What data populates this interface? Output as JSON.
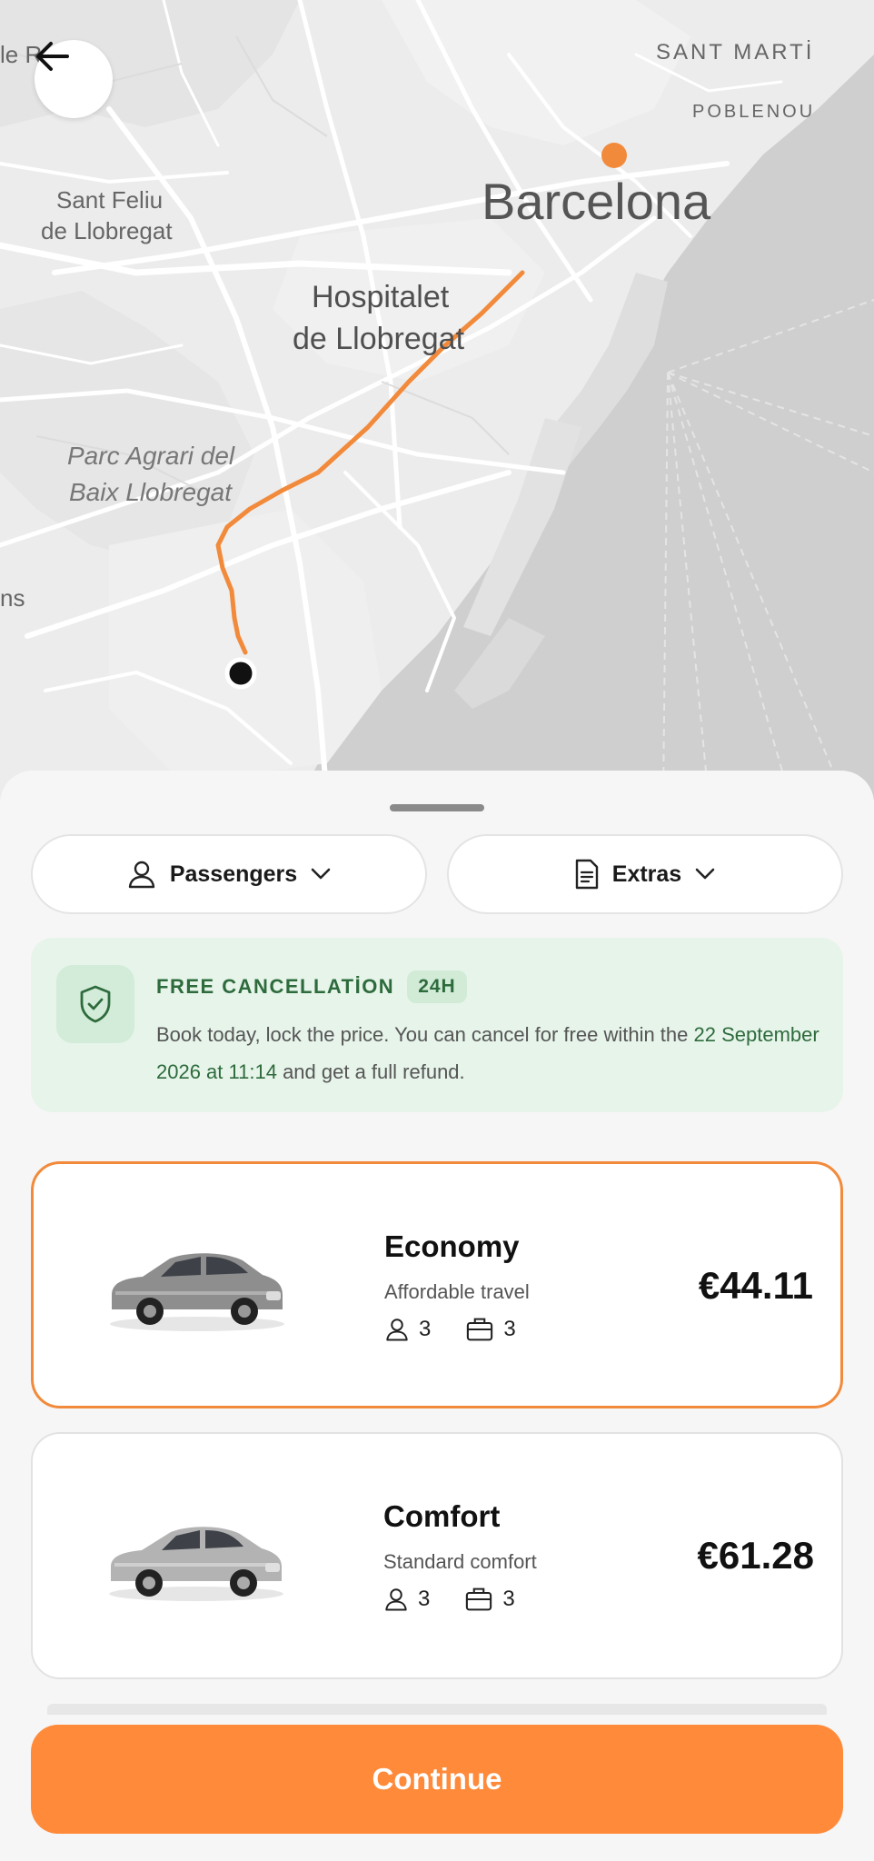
{
  "map": {
    "labels": {
      "barcelona": "Barcelona",
      "sant_marti": "SANT MARTİ",
      "poblenou": "POBLENOU",
      "sant_feliu_1": "Sant Feliu",
      "sant_feliu_2": "de Llobregat",
      "hospitalet_1": "Hospitalet",
      "hospitalet_2": "de Llobregat",
      "parc_1": "Parc Agrari del",
      "parc_2": "Baix Llobregat",
      "edge_left_top": "le R",
      "edge_left_mid": "ns"
    },
    "route_color": "#f28a3b"
  },
  "header": {
    "back_icon": "arrow-left-icon"
  },
  "filters": {
    "passengers_label": "Passengers",
    "extras_label": "Extras"
  },
  "cancellation": {
    "title": "FREE CANCELLATİON",
    "badge": "24H",
    "text_before": "Book today, lock the price. You can cancel for free within the",
    "date_highlight": "22 September 2026 at 11:14",
    "text_after": "and get a full refund."
  },
  "vehicles": [
    {
      "name": "Economy",
      "description": "Affordable travel",
      "passengers": "3",
      "luggage": "3",
      "price": "€44.11",
      "selected": true,
      "body_color": "#8e8e8e"
    },
    {
      "name": "Comfort",
      "description": "Standard comfort",
      "passengers": "3",
      "luggage": "3",
      "price": "€61.28",
      "selected": false,
      "body_color": "#b0b0b0"
    }
  ],
  "continue_label": "Continue",
  "colors": {
    "accent": "#ff8a3a",
    "success_bg": "#e6f4ea",
    "success_text": "#2e6b3c"
  }
}
